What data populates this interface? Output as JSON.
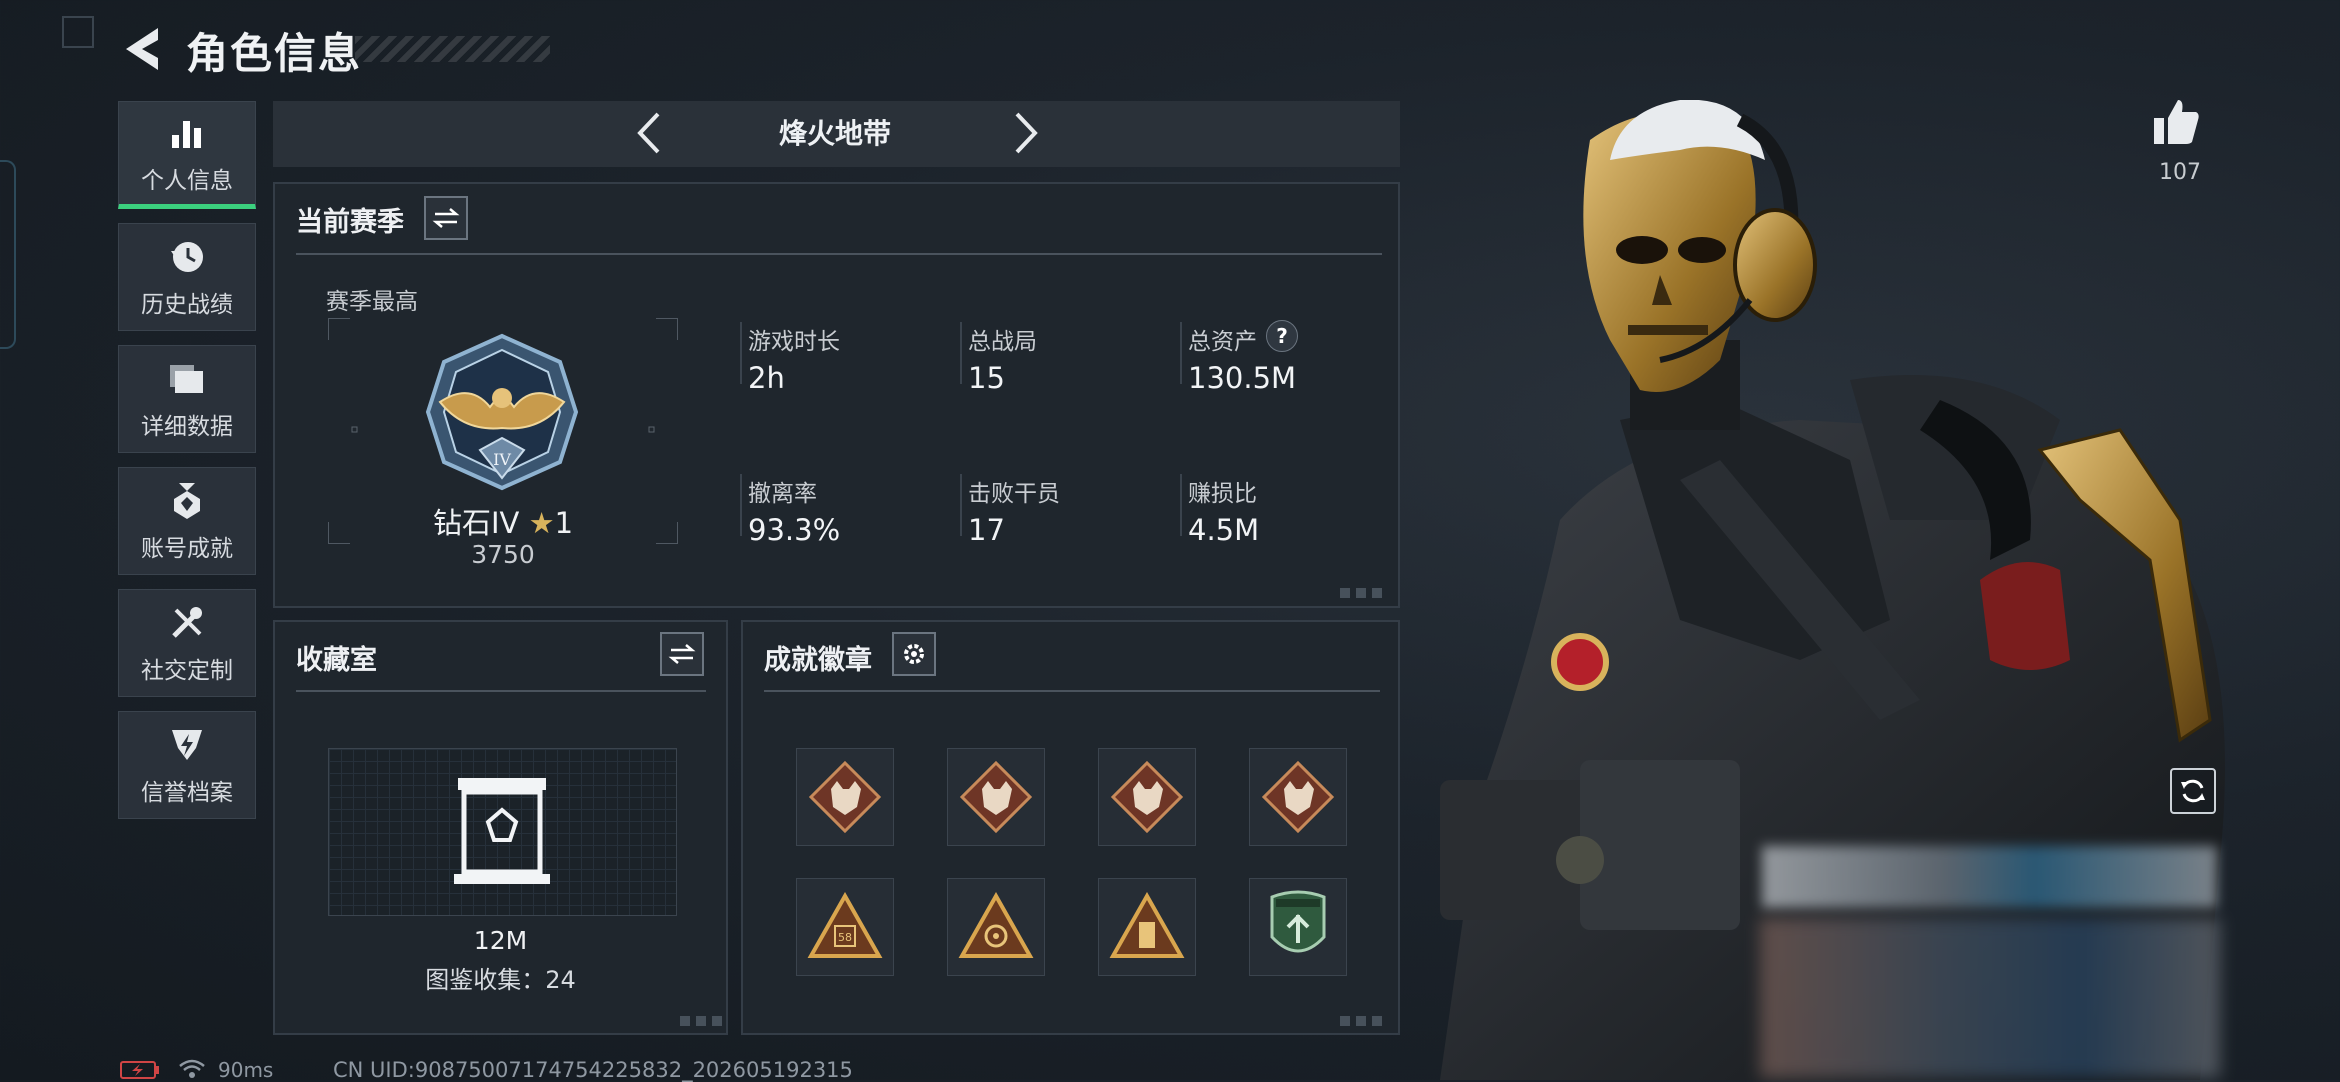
{
  "header": {
    "title": "角色信息"
  },
  "nav": [
    {
      "label": "个人信息",
      "icon": "bar-chart-icon",
      "active": true
    },
    {
      "label": "历史战绩",
      "icon": "history-clock-icon"
    },
    {
      "label": "详细数据",
      "icon": "folder-icon"
    },
    {
      "label": "账号成就",
      "icon": "medal-icon"
    },
    {
      "label": "社交定制",
      "icon": "tools-icon"
    },
    {
      "label": "信誉档案",
      "icon": "shield-bolt-icon"
    }
  ],
  "map_selector": {
    "name": "烽火地带"
  },
  "season": {
    "title": "当前赛季",
    "best_label": "赛季最高",
    "rank_name": "钻石IV",
    "rank_stars": "1",
    "rank_points": "3750",
    "stats": [
      {
        "label": "游戏时长",
        "value": "2h"
      },
      {
        "label": "总战局",
        "value": "15"
      },
      {
        "label": "总资产",
        "value": "130.5M"
      },
      {
        "label": "撤离率",
        "value": "93.3%"
      },
      {
        "label": "击败干员",
        "value": "17"
      },
      {
        "label": "赚损比",
        "value": "4.5M"
      }
    ]
  },
  "collection": {
    "title": "收藏室",
    "value": "12M",
    "codex_text": "图鉴收集：24"
  },
  "achievements": {
    "title": "成就徽章",
    "badges": [
      "wolf-badge",
      "wolf-badge",
      "wolf-badge",
      "wolf-badge",
      "triangle-badge-58",
      "triangle-badge-eye",
      "triangle-badge-tower",
      "green-shield-badge"
    ]
  },
  "likes": {
    "count": "107"
  },
  "status": {
    "ping": "90ms",
    "uid": "CN UID:9087500717475422583​2_202605192315"
  },
  "colors": {
    "accent_green": "#3bd07e",
    "gold": "#c89b4c",
    "badge_red": "#7a3a2a"
  }
}
